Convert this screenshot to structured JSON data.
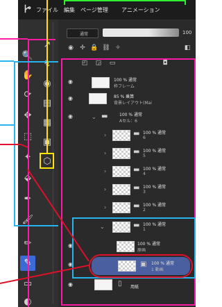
{
  "menubar": {
    "items": [
      {
        "label": "ファイル"
      },
      {
        "label": "編集"
      },
      {
        "label": "ページ管理"
      },
      {
        "label": "アニメーション"
      }
    ]
  },
  "layer_panel": {
    "blend_mode": "通常",
    "opacity": "100",
    "layers": [
      {
        "opacity": "100 %",
        "mode": "通常",
        "name": "枠フレーム"
      },
      {
        "opacity": "85 %",
        "mode": "乗算",
        "name": "背景レイアウト(Mai"
      },
      {
        "opacity": "100 %",
        "mode": "通常",
        "name": "Aセル：6"
      },
      {
        "opacity": "100 %",
        "mode": "通常",
        "name": "6"
      },
      {
        "opacity": "100 %",
        "mode": "通常",
        "name": "5"
      },
      {
        "opacity": "100 %",
        "mode": "通常",
        "name": "4"
      },
      {
        "opacity": "100 %",
        "mode": "通常",
        "name": "3"
      },
      {
        "opacity": "100 %",
        "mode": "通常",
        "name": "2"
      },
      {
        "opacity": "100 %",
        "mode": "通常",
        "name": "1"
      },
      {
        "opacity": "100 %",
        "mode": "通常",
        "name": "原画"
      },
      {
        "opacity": "100 %",
        "mode": "通常",
        "name": "1 動画"
      },
      {
        "opacity": "",
        "mode": "",
        "name": "用紙"
      }
    ]
  },
  "icons": {
    "app_logo": "clip-studio-logo-icon",
    "eye": "eye-icon",
    "folder": "folder-icon",
    "chevron": "chevron-down-icon"
  },
  "colors": {
    "callout_green": "#2ef02e",
    "callout_magenta": "#ff1aa3",
    "callout_blue": "#27b4f0",
    "callout_yellow": "#ffe600",
    "callout_red": "#e0102a",
    "selection": "#3d6bd6"
  }
}
